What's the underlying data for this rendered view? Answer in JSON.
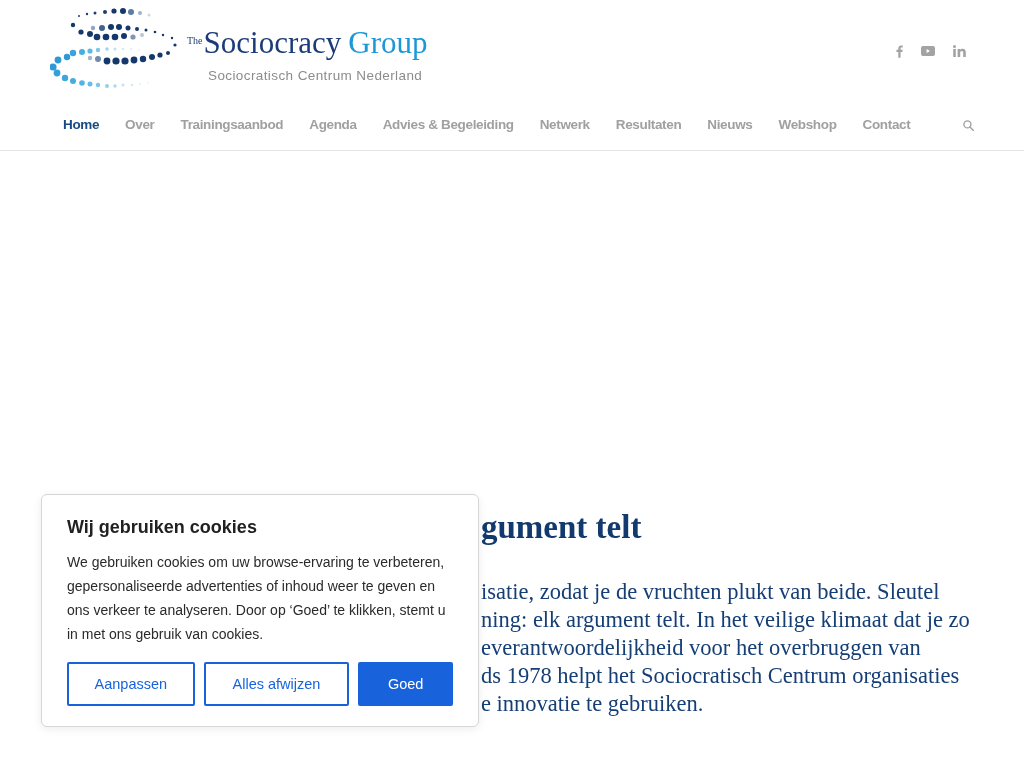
{
  "header": {
    "logo": {
      "prefix": "The",
      "name": "Sociocracy",
      "accent": "Group",
      "tagline": "Sociocratisch Centrum Nederland"
    },
    "social_links": [
      {
        "kind": "facebook"
      },
      {
        "kind": "youtube"
      },
      {
        "kind": "linkedin"
      }
    ]
  },
  "nav": {
    "items": [
      {
        "label": "Home",
        "selected": true
      },
      {
        "label": "Over",
        "selected": false
      },
      {
        "label": "Trainingsaanbod",
        "selected": false
      },
      {
        "label": "Agenda",
        "selected": false
      },
      {
        "label": "Advies & Begeleiding",
        "selected": false
      },
      {
        "label": "Netwerk",
        "selected": false
      },
      {
        "label": "Resultaten",
        "selected": false
      },
      {
        "label": "Nieuws",
        "selected": false
      },
      {
        "label": "Webshop",
        "selected": false
      },
      {
        "label": "Contact",
        "selected": false
      }
    ]
  },
  "content": {
    "heading": "gument telt",
    "lines": [
      "isatie, zodat je de vruchten plukt van beide. Sleutel",
      "ning: elk argument telt. In het veilige klimaat dat je zo",
      "everantwoordelijkheid voor het overbruggen van",
      "ds 1978 helpt het Sociocratisch Centrum organisaties",
      "e innovatie te gebruiken."
    ]
  },
  "cookie_dialog": {
    "title": "Wij gebruiken cookies",
    "text": "We gebruiken cookies om uw browse-ervaring te verbeteren, gepersonaliseerde advertenties of inhoud weer te geven en ons verkeer te analyseren. Door op ‘Goed’ te klikken, stemt u in met ons gebruik van cookies.",
    "buttons": [
      {
        "label": "Aanpassen",
        "kind": "outline"
      },
      {
        "label": "Alles afwijzen",
        "kind": "outline"
      },
      {
        "label": "Goed",
        "kind": "filled"
      }
    ]
  }
}
